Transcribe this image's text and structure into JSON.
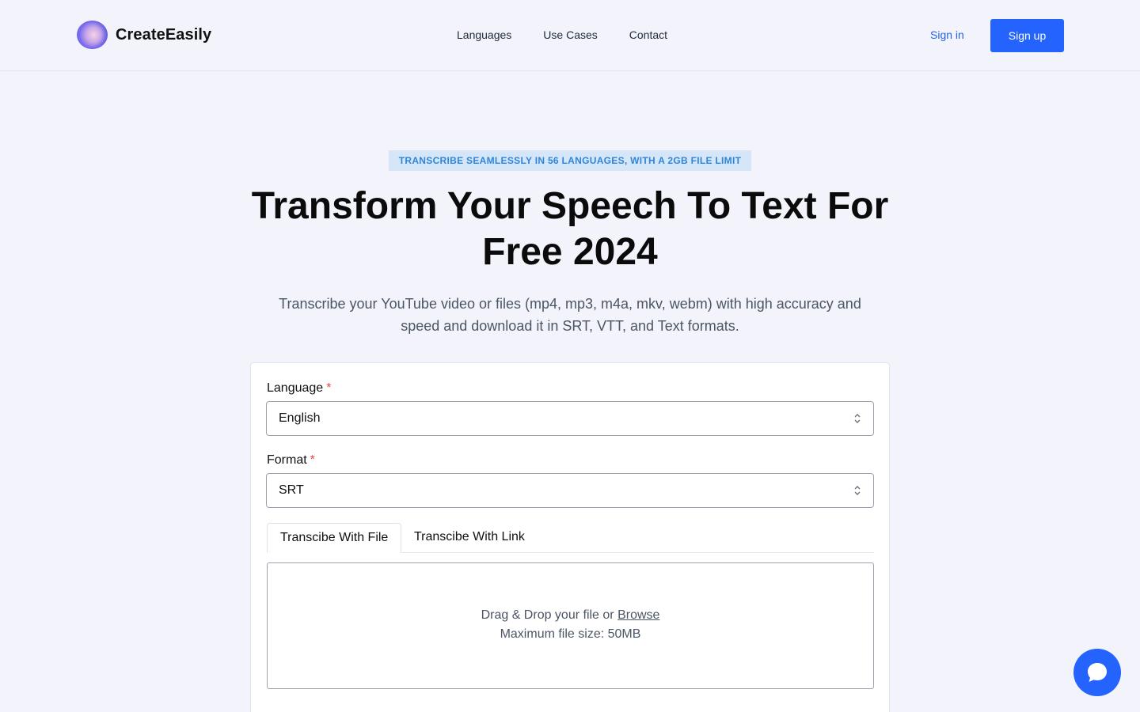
{
  "brand": {
    "name": "CreateEasily"
  },
  "nav": {
    "items": [
      "Languages",
      "Use Cases",
      "Contact"
    ]
  },
  "auth": {
    "signin": "Sign in",
    "signup": "Sign up"
  },
  "hero": {
    "badge": "TRANSCRIBE SEAMLESSLY IN 56 LANGUAGES, WITH A 2GB FILE LIMIT",
    "title": "Transform Your Speech To Text For Free 2024",
    "subtitle": "Transcribe your YouTube video or files (mp4, mp3, m4a, mkv, webm) with high accuracy and speed and download it in SRT, VTT, and Text formats."
  },
  "form": {
    "language_label": "Language",
    "language_value": "English",
    "format_label": "Format",
    "format_value": "SRT",
    "required_mark": "*",
    "tabs": [
      "Transcibe With File",
      "Transcibe With Link"
    ],
    "active_tab": 0,
    "dropzone": {
      "prefix": "Drag & Drop your file or ",
      "browse": "Browse",
      "max_size": "Maximum file size: 50MB"
    }
  },
  "colors": {
    "accent": "#2563ff",
    "link": "#2563eb",
    "badge_bg": "#d5e6f8",
    "badge_text": "#2f85d8",
    "required": "#ef4444"
  },
  "icons": {
    "chat": "chat-bubble-icon",
    "chevron": "chevron-up-down-icon"
  }
}
